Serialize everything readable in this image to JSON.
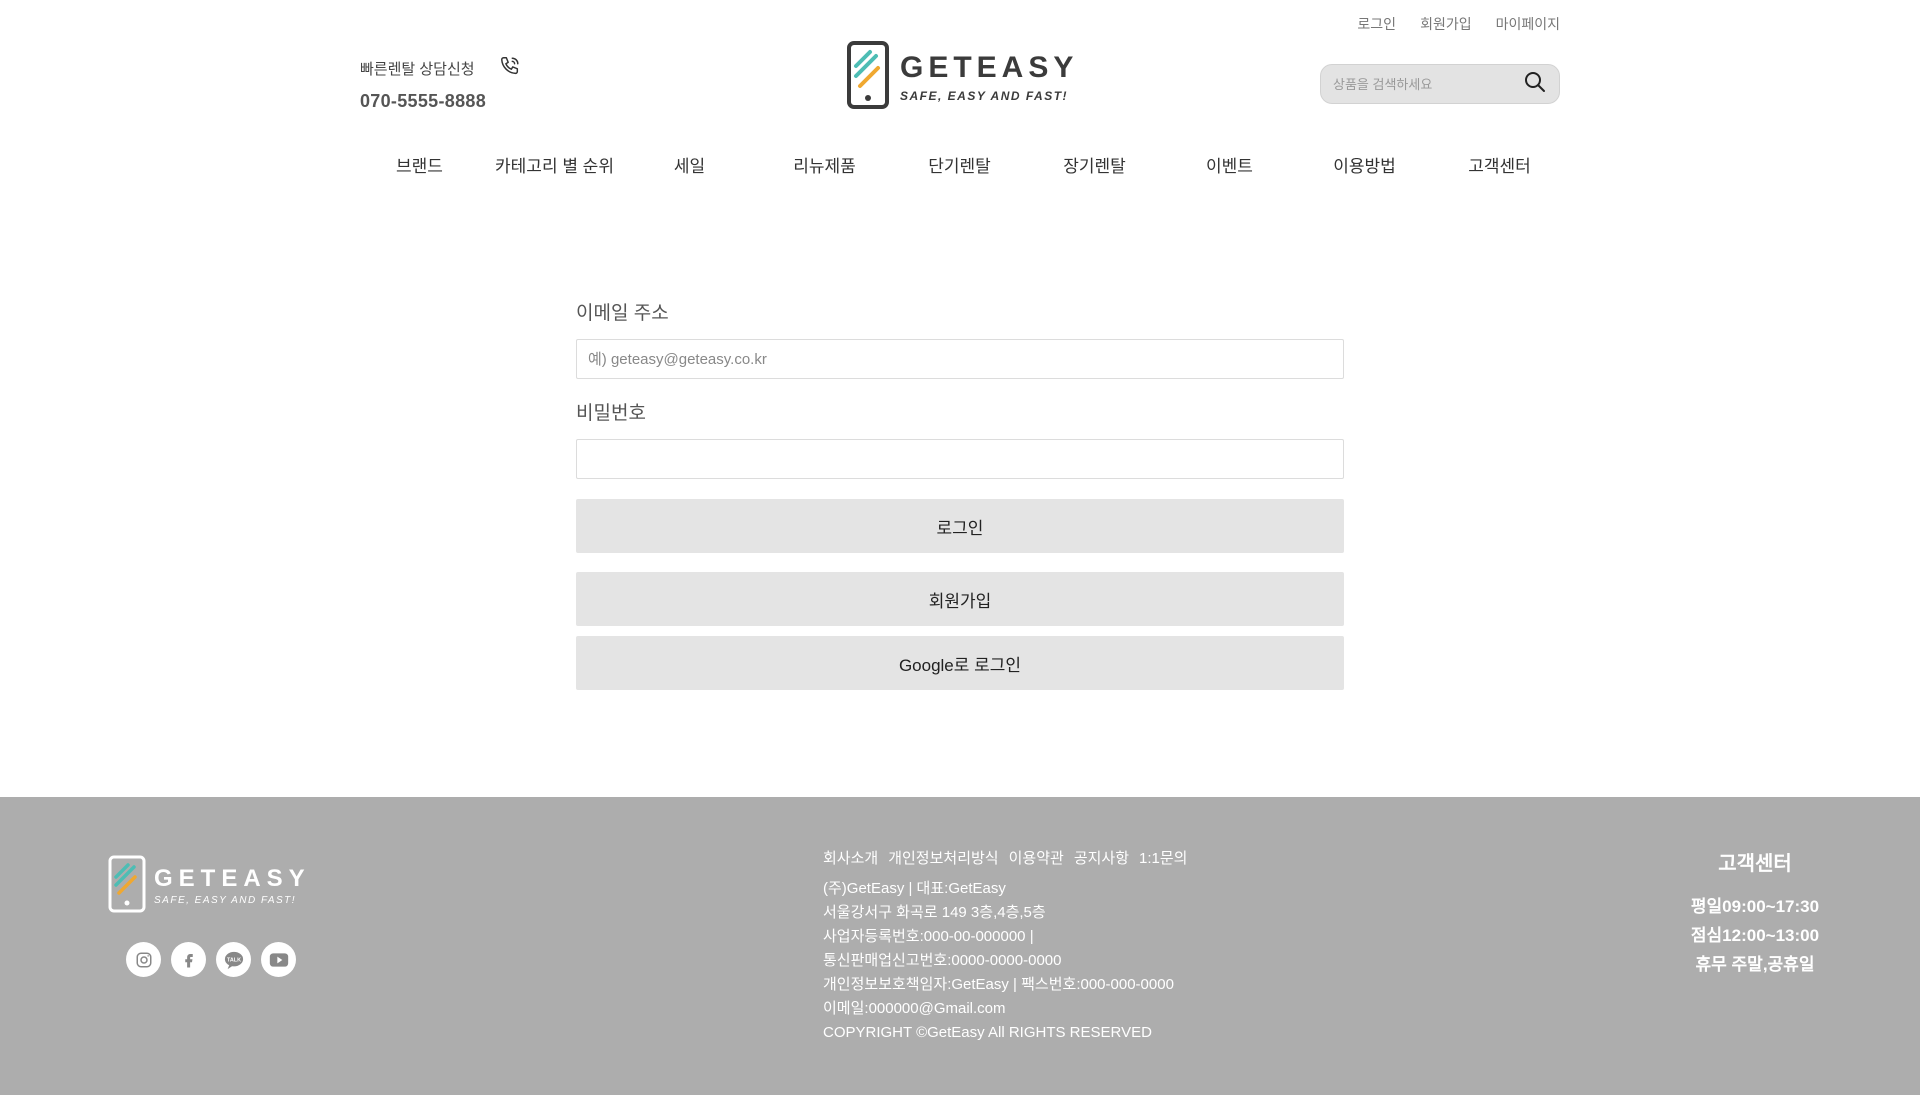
{
  "header": {
    "top_links": [
      "로그인",
      "회원가입",
      "마이페이지"
    ],
    "quick_rental_label": "빠른렌탈 상담신청",
    "phone_number": "070-5555-8888",
    "logo_title": "GETEASY",
    "logo_subtitle": "SAFE, EASY AND FAST!",
    "search_placeholder": "상품을 검색하세요",
    "nav": [
      "브랜드",
      "카테고리 별 순위",
      "세일",
      "리뉴제품",
      "단기렌탈",
      "장기렌탈",
      "이벤트",
      "이용방법",
      "고객센터"
    ]
  },
  "login_form": {
    "email_label": "이메일 주소",
    "email_placeholder": "예) geteasy@geteasy.co.kr",
    "password_label": "비밀번호",
    "login_button": "로그인",
    "signup_button": "회원가입",
    "google_button": "Google로 로그인"
  },
  "footer": {
    "logo_title": "GETEASY",
    "logo_subtitle": "SAFE, EASY AND FAST!",
    "links": [
      "회사소개",
      "개인정보처리방식",
      "이용약관",
      "공지사항",
      "1:1문의"
    ],
    "info_lines": [
      "(주)GetEasy | 대표:GetEasy",
      "서울강서구 화곡로 149 3층,4층,5층",
      "사업자등록번호:000-00-000000 |",
      "통신판매업신고번호:0000-0000-0000",
      "개인정보보호책임자:GetEasy | 팩스번호:000-000-0000",
      "이메일:000000@Gmail.com",
      "COPYRIGHT ©GetEasy All RIGHTS RESERVED"
    ],
    "customer_center_title": "고객센터",
    "hours": [
      "평일09:00~17:30",
      "점심12:00~13:00",
      "휴무 주말,공휴일"
    ],
    "social_icons": [
      "instagram-icon",
      "facebook-icon",
      "kakaotalk-icon",
      "youtube-icon"
    ]
  },
  "colors": {
    "logo_teal": "#4dbdb4",
    "logo_orange": "#f0a830",
    "button_bg": "#e4e4e4",
    "footer_bg": "#adadad"
  }
}
